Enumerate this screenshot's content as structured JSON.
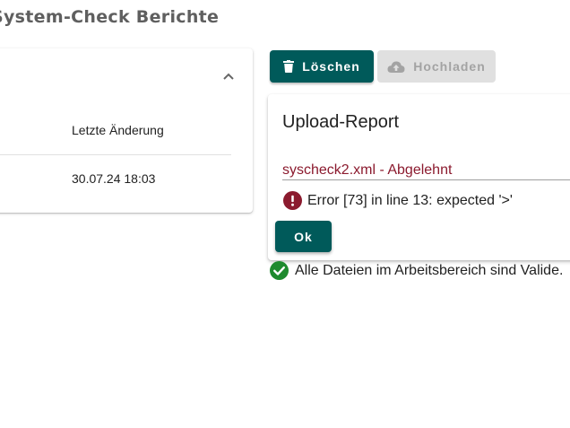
{
  "page": {
    "title": "System-Check Berichte"
  },
  "reports_table": {
    "column_last_modified": "Letzte Änderung",
    "rows": [
      {
        "last_modified": "30.07.24 18:03"
      }
    ],
    "collapse_icon": "chevron-up-icon"
  },
  "toolbar": {
    "delete_label": "Löschen",
    "delete_icon": "trash-icon",
    "upload_label": "Hochladen",
    "upload_icon": "cloud-upload-icon",
    "upload_disabled": true
  },
  "upload_report": {
    "title": "Upload-Report",
    "file_status": "syscheck2.xml - Abgelehnt",
    "error_message": "Error [73] in line 13: expected '>'",
    "error_icon": "error-icon",
    "ok_label": "Ok"
  },
  "status": {
    "message": "Alle Dateien im Arbeitsbereich sind Valide.",
    "icon": "check-circle-icon"
  },
  "colors": {
    "primary": "#005a5a",
    "error": "#8b1a2e",
    "success": "#1e8a2e",
    "disabled_bg": "#e0e0e0",
    "disabled_text": "#a3a3a3"
  }
}
